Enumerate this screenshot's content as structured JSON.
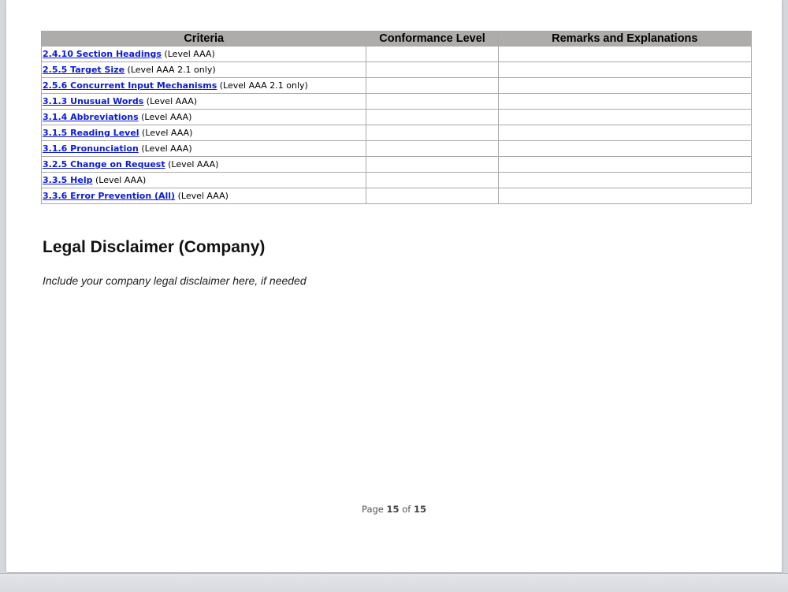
{
  "table": {
    "headers": [
      "Criteria",
      "Conformance Level",
      "Remarks and Explanations"
    ],
    "rows": [
      {
        "link": "2.4.10 Section Headings",
        "level": " (Level AAA)",
        "conformance": "",
        "remarks": ""
      },
      {
        "link": "2.5.5 Target Size",
        "level": " (Level AAA 2.1 only)",
        "conformance": "",
        "remarks": ""
      },
      {
        "link": "2.5.6 Concurrent Input Mechanisms",
        "level": " (Level AAA 2.1 only)",
        "conformance": "",
        "remarks": ""
      },
      {
        "link": "3.1.3 Unusual Words",
        "level": " (Level AAA)",
        "conformance": "",
        "remarks": ""
      },
      {
        "link": "3.1.4 Abbreviations",
        "level": " (Level AAA)",
        "conformance": "",
        "remarks": ""
      },
      {
        "link": "3.1.5 Reading Level",
        "level": " (Level AAA)",
        "conformance": "",
        "remarks": ""
      },
      {
        "link": "3.1.6 Pronunciation",
        "level": " (Level AAA)",
        "conformance": "",
        "remarks": ""
      },
      {
        "link": "3.2.5 Change on Request",
        "level": " (Level AAA)",
        "conformance": "",
        "remarks": ""
      },
      {
        "link": "3.3.5 Help",
        "level": " (Level AAA)",
        "conformance": "",
        "remarks": ""
      },
      {
        "link": "3.3.6 Error Prevention (All)",
        "level": " (Level AAA)",
        "conformance": "",
        "remarks": ""
      }
    ]
  },
  "section": {
    "title": "Legal Disclaimer (Company)",
    "body": "Include your company legal disclaimer here, if needed"
  },
  "footer": {
    "prefix": "Page ",
    "current": "15",
    "separator": " of ",
    "total": "15"
  }
}
